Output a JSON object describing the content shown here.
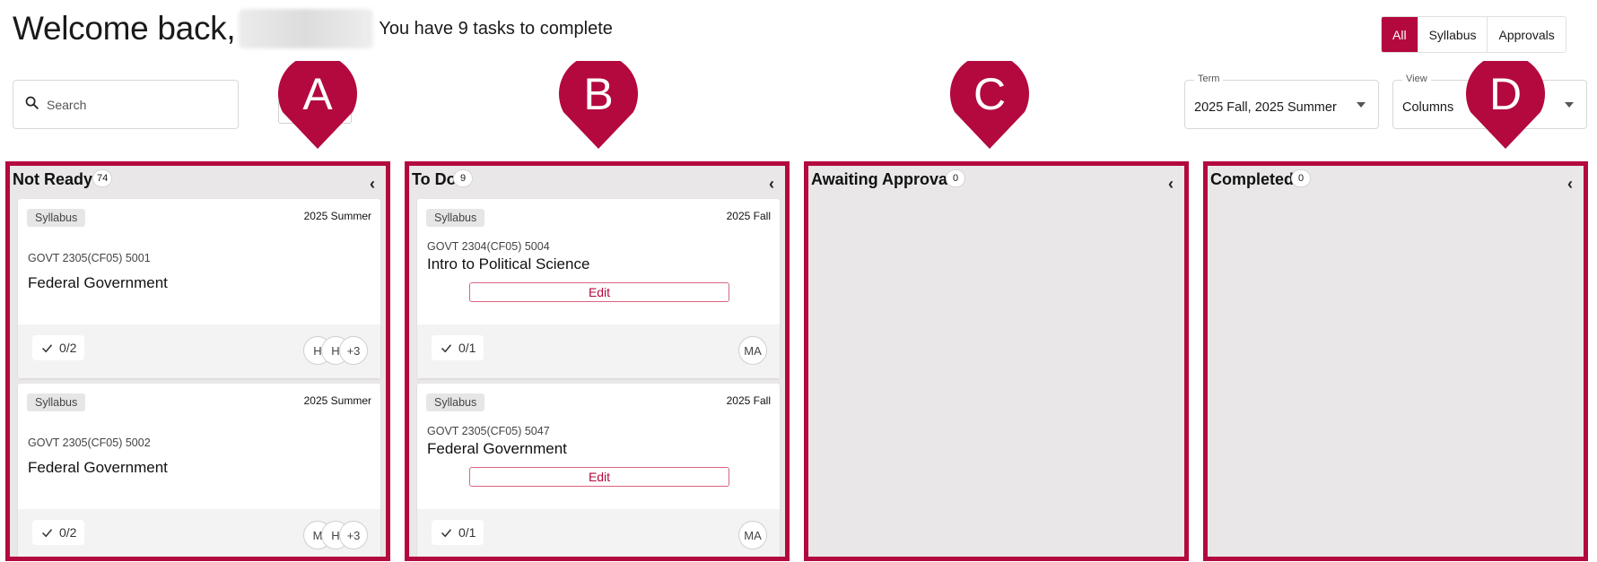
{
  "header": {
    "welcome": "Welcome back,",
    "tasks_text": "You have 9 tasks to complete"
  },
  "filters": [
    {
      "label": "All",
      "active": true
    },
    {
      "label": "Syllabus",
      "active": false
    },
    {
      "label": "Approvals",
      "active": false
    }
  ],
  "search": {
    "placeholder": "Search"
  },
  "term_select": {
    "label": "Term",
    "value": "2025 Fall, 2025 Summer"
  },
  "view_select": {
    "label": "View",
    "value": "Columns"
  },
  "markers": [
    "A",
    "B",
    "C",
    "D"
  ],
  "accent_color": "#b3093e",
  "columns": [
    {
      "title": "Not Ready",
      "count": "74",
      "cards": [
        {
          "badge": "Syllabus",
          "term": "2025 Summer",
          "code": "GOVT 2305(CF05) 5001",
          "course": "Federal Government",
          "progress": "0/2",
          "avatars": [
            "H",
            "H",
            "+3"
          ]
        },
        {
          "badge": "Syllabus",
          "term": "2025 Summer",
          "code": "GOVT 2305(CF05) 5002",
          "course": "Federal Government",
          "progress": "0/2",
          "avatars": [
            "M",
            "H",
            "+3"
          ]
        }
      ]
    },
    {
      "title": "To Do",
      "count": "9",
      "cards": [
        {
          "badge": "Syllabus",
          "term": "2025 Fall",
          "code": "GOVT 2304(CF05) 5004",
          "course": "Intro to Political Science",
          "edit_label": "Edit",
          "progress": "0/1",
          "avatars": [
            "MA"
          ]
        },
        {
          "badge": "Syllabus",
          "term": "2025 Fall",
          "code": "GOVT 2305(CF05) 5047",
          "course": "Federal Government",
          "edit_label": "Edit",
          "progress": "0/1",
          "avatars": [
            "MA"
          ]
        }
      ]
    },
    {
      "title": "Awaiting Approval",
      "count": "0",
      "cards": []
    },
    {
      "title": "Completed",
      "count": "0",
      "cards": []
    }
  ]
}
